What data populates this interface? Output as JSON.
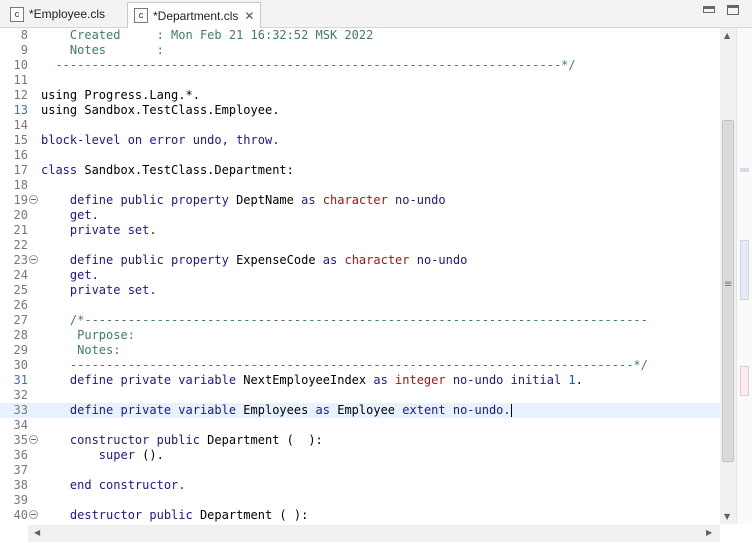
{
  "tabs": [
    {
      "label": "*Employee.cls",
      "icon": "cls-file-icon",
      "active": false
    },
    {
      "label": "*Department.cls",
      "icon": "cls-file-icon",
      "active": true,
      "close": "✕"
    }
  ],
  "icon_letter": "c",
  "lines": [
    {
      "n": "8",
      "segs": [
        [
          "c-comment",
          "    Created     : Mon Feb 21 16:32:52 MSK 2022"
        ]
      ]
    },
    {
      "n": "9",
      "segs": [
        [
          "c-comment",
          "    Notes       :"
        ]
      ]
    },
    {
      "n": "10",
      "segs": [
        [
          "c-comment",
          "  ----------------------------------------------------------------------*/"
        ]
      ]
    },
    {
      "n": "11",
      "segs": []
    },
    {
      "n": "12",
      "segs": [
        [
          "",
          "using Progress.Lang.*."
        ]
      ]
    },
    {
      "n": "13",
      "segs": [
        [
          "",
          "using Sandbox.TestClass.Employee."
        ]
      ],
      "modified": true
    },
    {
      "n": "14",
      "segs": []
    },
    {
      "n": "15",
      "segs": [
        [
          "c-kw",
          "block-level on error undo, throw."
        ]
      ]
    },
    {
      "n": "16",
      "segs": []
    },
    {
      "n": "17",
      "segs": [
        [
          "c-kw",
          "class "
        ],
        [
          "",
          "Sandbox.TestClass.Department:"
        ]
      ]
    },
    {
      "n": "18",
      "segs": []
    },
    {
      "n": "19",
      "fold": true,
      "segs": [
        [
          "c-kw",
          "    define public property "
        ],
        [
          "",
          "DeptName "
        ],
        [
          "c-kw",
          "as "
        ],
        [
          "c-type",
          "character "
        ],
        [
          "c-kw",
          "no-undo"
        ]
      ]
    },
    {
      "n": "20",
      "segs": [
        [
          "c-kw",
          "    get."
        ]
      ]
    },
    {
      "n": "21",
      "segs": [
        [
          "c-kw",
          "    private set."
        ]
      ]
    },
    {
      "n": "22",
      "segs": []
    },
    {
      "n": "23",
      "fold": true,
      "segs": [
        [
          "c-kw",
          "    define public property "
        ],
        [
          "",
          "ExpenseCode "
        ],
        [
          "c-kw",
          "as "
        ],
        [
          "c-type",
          "character "
        ],
        [
          "c-kw",
          "no-undo"
        ]
      ]
    },
    {
      "n": "24",
      "segs": [
        [
          "c-kw",
          "    get."
        ]
      ]
    },
    {
      "n": "25",
      "segs": [
        [
          "c-kw",
          "    private set."
        ]
      ]
    },
    {
      "n": "26",
      "segs": []
    },
    {
      "n": "27",
      "segs": [
        [
          "c-comment",
          "    /*------------------------------------------------------------------------------"
        ]
      ]
    },
    {
      "n": "28",
      "segs": [
        [
          "c-comment",
          "     Purpose:"
        ]
      ]
    },
    {
      "n": "29",
      "segs": [
        [
          "c-comment",
          "     Notes:"
        ]
      ]
    },
    {
      "n": "30",
      "segs": [
        [
          "c-comment",
          "    ------------------------------------------------------------------------------*/"
        ]
      ]
    },
    {
      "n": "31",
      "modified": true,
      "segs": [
        [
          "c-kw",
          "    define private variable "
        ],
        [
          "",
          "NextEmployeeIndex "
        ],
        [
          "c-kw",
          "as "
        ],
        [
          "c-type",
          "integer "
        ],
        [
          "c-kw",
          "no-undo initial "
        ],
        [
          "c-num",
          "1"
        ],
        [
          "",
          "."
        ]
      ]
    },
    {
      "n": "32",
      "segs": []
    },
    {
      "n": "33",
      "current": true,
      "caret": true,
      "segs": [
        [
          "c-kw",
          "    define private variable "
        ],
        [
          "",
          "Employees "
        ],
        [
          "c-kw",
          "as "
        ],
        [
          "",
          "Employee "
        ],
        [
          "c-kw",
          "extent no-undo."
        ]
      ]
    },
    {
      "n": "34",
      "segs": []
    },
    {
      "n": "35",
      "fold": true,
      "segs": [
        [
          "c-kw",
          "    constructor public "
        ],
        [
          "",
          "Department ( "
        ],
        [
          "",
          " ):"
        ]
      ]
    },
    {
      "n": "36",
      "segs": [
        [
          "c-kw",
          "        super "
        ],
        [
          "",
          "()."
        ]
      ]
    },
    {
      "n": "37",
      "segs": []
    },
    {
      "n": "38",
      "segs": [
        [
          "c-kw",
          "    end constructor."
        ]
      ]
    },
    {
      "n": "39",
      "segs": []
    },
    {
      "n": "40",
      "fold": true,
      "segs": [
        [
          "c-kw",
          "    destructor public "
        ],
        [
          "",
          "Department ( ):"
        ]
      ]
    }
  ],
  "scroll": {
    "up": "▲",
    "down": "▼",
    "left": "◀",
    "right": "▶"
  },
  "colors": {
    "comment": "#3f7f5f",
    "keyword": "#1a1a8c",
    "type": "#a31515",
    "number": "#0b5bd3",
    "current_line": "#e8f2fe"
  }
}
